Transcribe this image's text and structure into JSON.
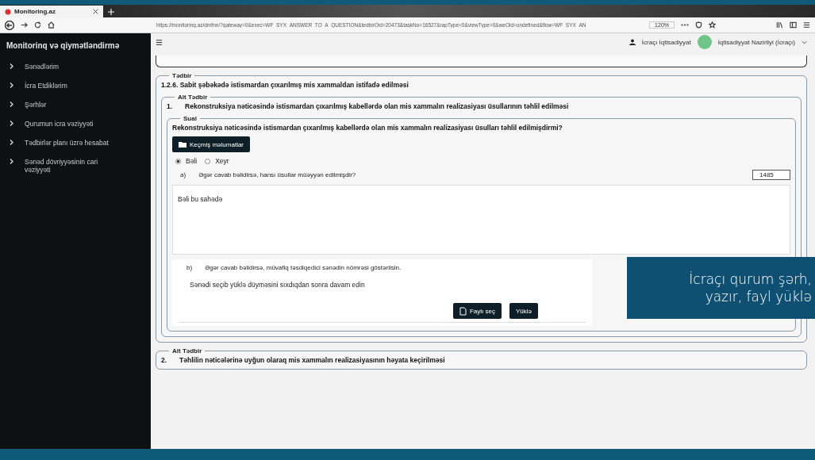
{
  "browser": {
    "tab_title": "Monitoring.az",
    "url": "https://monitoring.az/dmfnn/?gateway=0&exec=WF_SYX_ANSWER_TO_A_QUESTION&tedbirOid=20473&taskNo=16527&rapType=0&viewType=0&weOid=undefined&flow=WF_SYX_AN",
    "zoom": "120%"
  },
  "sidebar": {
    "title": "Monitorinq və qiymətləndirmə",
    "items": [
      {
        "label": "Sənədlərim"
      },
      {
        "label": "İcra Etdiklərim"
      },
      {
        "label": "Şərhlər"
      },
      {
        "label": "Qurumun icra vəziyyəti"
      },
      {
        "label": "Tədbirlər planı üzrə hesabat"
      },
      {
        "label": "Sənəd dövriyyəsinin cari vəziyyəti"
      }
    ]
  },
  "header": {
    "user": "İcraçı İqtisadiyyat",
    "organization": "İqtisadiyyat Nazirliyi (İcraçı)"
  },
  "tadbir": {
    "legend": "Tədbir",
    "title": "1.2.6. Sabit şəbəkədə istismardan çıxarılmış mis xammaldan istifadə edilməsi"
  },
  "alt_tadbir": {
    "legend": "Alt Tədbir",
    "number": "1.",
    "title": "Rekonstruksiya nəticəsində istismardan çıxarılmış kabellərdə olan mis xammalın realizasiyası üsullarının təhlil edilməsi"
  },
  "sual": {
    "legend": "Sual",
    "question": "Rekonstruksiya nəticəsində istismardan çıxarılmış kabellərdə olan mis xammalın realizasiyası üsulları təhlil edilmişdirmi?",
    "history_button": "Keçmiş məlumatlar",
    "options": [
      {
        "label": "Bəli",
        "selected": true
      },
      {
        "label": "Xeyr",
        "selected": false
      }
    ],
    "part_a": {
      "marker": "a)",
      "text": "Əgər cavab bəlidirsə, hansı üsullar müəyyən edilmişdir?",
      "counter": "1485",
      "answer": "Bəli bu sahədə"
    },
    "part_b": {
      "marker": "b)",
      "text": "Əgər cavab bəlidirsə, müvafiq təsdiqedici sənədin nömrəsi göstərilsin.",
      "instruction": "Sənədi seçib yüklə düyməsini sıxdıqdan sonra davam edin",
      "choose_button": "Faylı seç",
      "upload_button": "Yüklə"
    }
  },
  "alt_tadbir_2": {
    "legend": "Alt Tədbir",
    "number": "2.",
    "title": "Təhlilin nəticələrinə uyğun olaraq mis xammalın realizasiyasının həyata keçirilməsi"
  },
  "caption": {
    "lines": [
      "İcraçı qurum şərh,",
      "yazır, fayl yüklə"
    ]
  }
}
